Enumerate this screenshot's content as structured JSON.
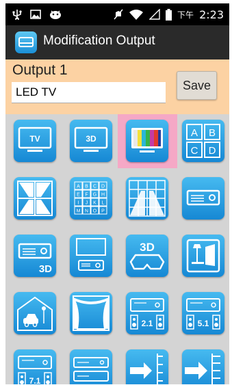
{
  "status_bar": {
    "ampm": "下午",
    "time": "2:23",
    "icons": [
      "usb-icon",
      "image-icon",
      "android-icon",
      "mute-icon",
      "wifi-icon",
      "signal-icon",
      "battery-icon"
    ]
  },
  "action_bar": {
    "title": "Modification Output",
    "icon": "output-device-icon"
  },
  "output": {
    "label": "Output 1",
    "name_value": "LED TV",
    "save_label": "Save"
  },
  "grid": {
    "selected_index": 2,
    "accent_color": "#1a9be3",
    "selection_color": "#f5a8c6",
    "tiles": [
      {
        "icon": "tv-icon",
        "text": "TV"
      },
      {
        "icon": "tv-3d-icon",
        "text": "3D"
      },
      {
        "icon": "color-bars-monitor-icon",
        "text": ""
      },
      {
        "icon": "quad-view-icon",
        "letters": [
          "A",
          "B",
          "C",
          "D"
        ]
      },
      {
        "icon": "road-icon",
        "text": ""
      },
      {
        "icon": "sixteen-view-icon",
        "letters": [
          "A",
          "B",
          "C",
          "D",
          "E",
          "F",
          "G",
          "H",
          "I",
          "J",
          "K",
          "L",
          "M",
          "N",
          "O",
          "P"
        ]
      },
      {
        "icon": "video-wall-icon",
        "text": ""
      },
      {
        "icon": "projector-icon",
        "text": ""
      },
      {
        "icon": "projector-3d-icon",
        "text": "3D"
      },
      {
        "icon": "projector-screen-icon",
        "text": ""
      },
      {
        "icon": "glasses-3d-icon",
        "text": "3D"
      },
      {
        "icon": "screen-lamp-icon",
        "text": ""
      },
      {
        "icon": "garage-car-icon",
        "text": ""
      },
      {
        "icon": "theater-curtain-icon",
        "text": ""
      },
      {
        "icon": "receiver-2-1-icon",
        "text": "2.1"
      },
      {
        "icon": "receiver-5-1-icon",
        "text": "5.1"
      },
      {
        "icon": "receiver-7-1-icon",
        "text": "7.1"
      },
      {
        "icon": "dvd-player-icon",
        "text": ""
      },
      {
        "icon": "splitter-arrow-icon",
        "text": ""
      },
      {
        "icon": "splitter-arrow-wide-icon",
        "text": ""
      }
    ]
  }
}
